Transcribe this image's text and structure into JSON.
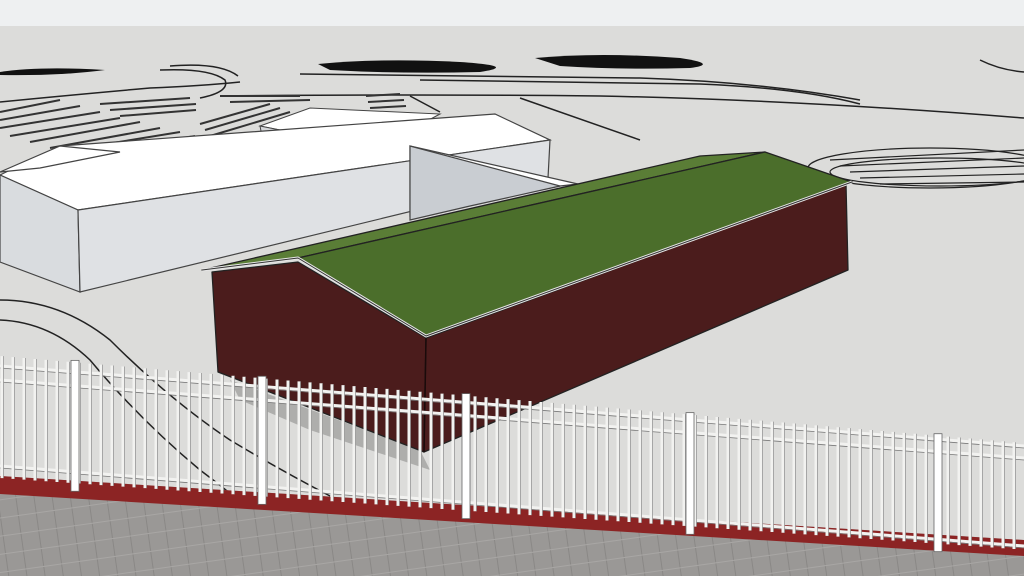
{
  "viewport": {
    "kind": "3D model viewport"
  },
  "scene": {
    "sky_color": "#eef0f1",
    "ground_color": "#dcdcda",
    "main_building": {
      "roof_color": "#4b6e2b",
      "wall_color": "#4b1c1c"
    },
    "other_buildings": {
      "roof_color": "#ffffff",
      "wall_color": "#d9dcdf"
    },
    "fence": {
      "color": "#f2f2f0",
      "style": "picket railing"
    },
    "walkway": {
      "curb_color": "#8c2424",
      "paving_color": "#9a9896"
    }
  }
}
